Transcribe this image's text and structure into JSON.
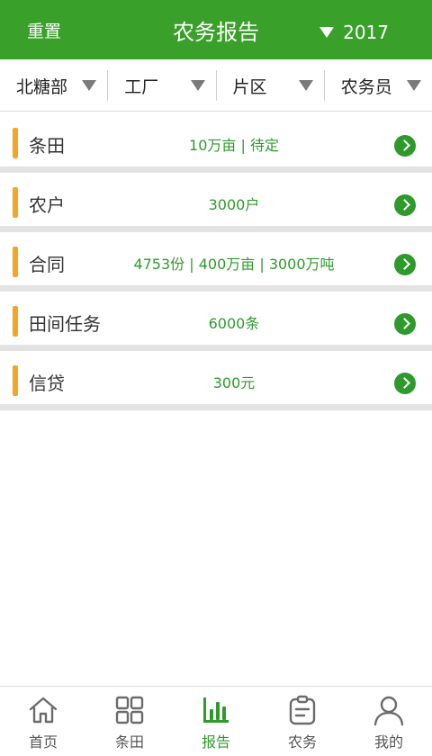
{
  "header": {
    "reset_label": "重置",
    "title": "农务报告",
    "year": "2017"
  },
  "filters": [
    {
      "label": "北糖部"
    },
    {
      "label": "工厂"
    },
    {
      "label": "片区"
    },
    {
      "label": "农务员"
    }
  ],
  "rows": [
    {
      "label": "条田",
      "value": "10万亩  |  待定"
    },
    {
      "label": "农户",
      "value": "3000户"
    },
    {
      "label": "合同",
      "value": "4753份  |  400万亩  |  3000万吨"
    },
    {
      "label": "田间任务",
      "value": "6000条"
    },
    {
      "label": "信贷",
      "value": "300元"
    }
  ],
  "nav": [
    {
      "label": "首页",
      "icon": "home-icon"
    },
    {
      "label": "条田",
      "icon": "grid-icon"
    },
    {
      "label": "报告",
      "icon": "bar-chart-icon",
      "active": true
    },
    {
      "label": "农务",
      "icon": "clipboard-icon"
    },
    {
      "label": "我的",
      "icon": "user-icon"
    }
  ],
  "colors": {
    "primary_green": "#39a029",
    "accent_orange": "#f2a623",
    "value_green": "#2e9a2b"
  }
}
